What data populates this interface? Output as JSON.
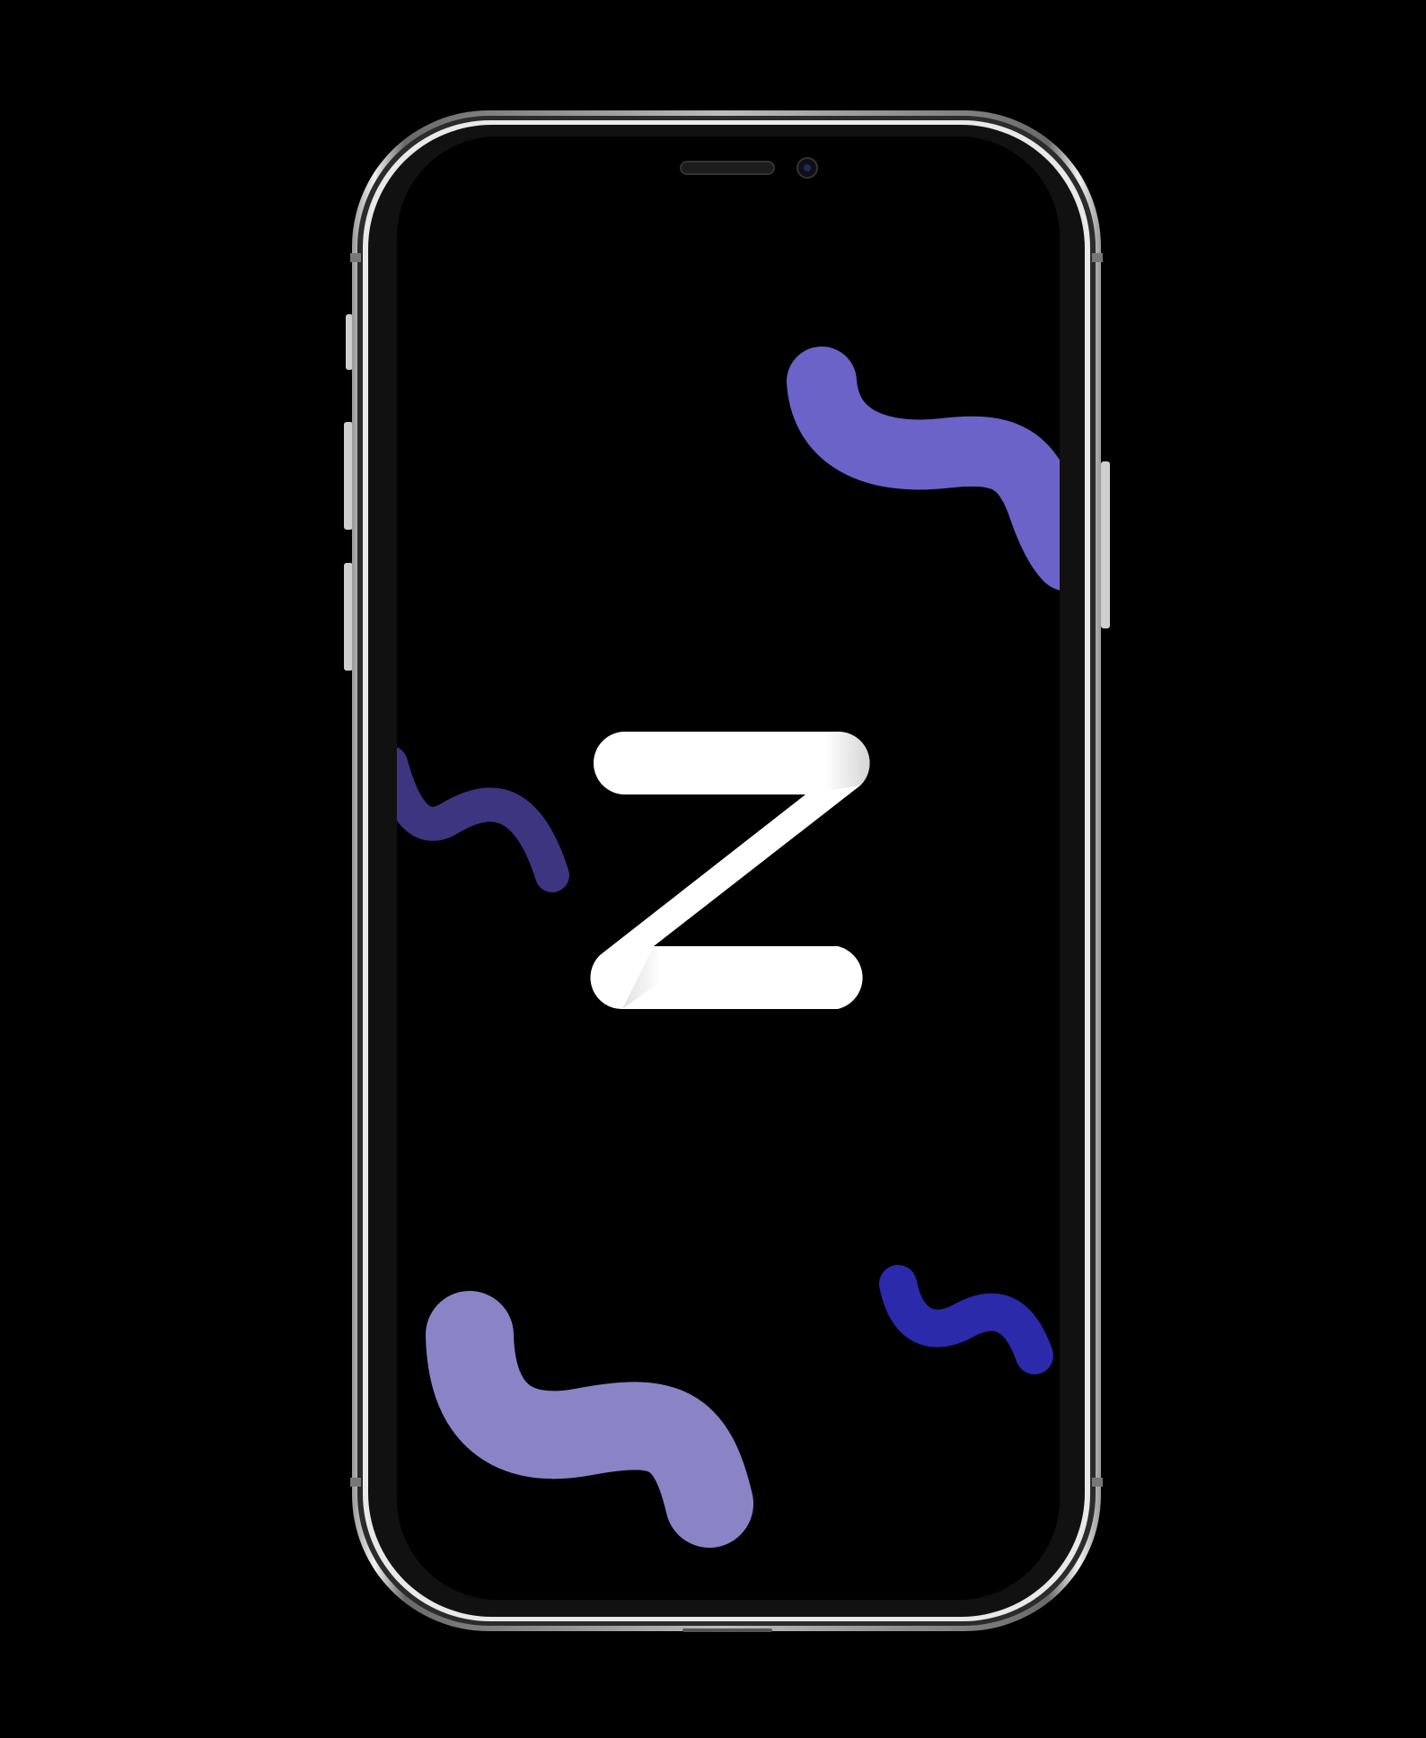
{
  "colors": {
    "page_background": "#000000",
    "screen_background": "#000000",
    "frame_metal": "#d9d9d9",
    "logo": "#ffffff",
    "accent_light": "#6c63c8",
    "accent_pale": "#8a84c6",
    "accent_dark": "#3d3580",
    "accent_deep": "#2a2aaa"
  },
  "device": {
    "type": "smartphone-bezel-less",
    "icons": [
      "earpiece-speaker",
      "front-camera"
    ]
  },
  "screen": {
    "type": "splash-screen",
    "logo_icon": "z-logo-icon",
    "decorations": [
      "squiggle-top-right",
      "squiggle-left",
      "squiggle-bottom-left",
      "squiggle-bottom-right"
    ]
  }
}
